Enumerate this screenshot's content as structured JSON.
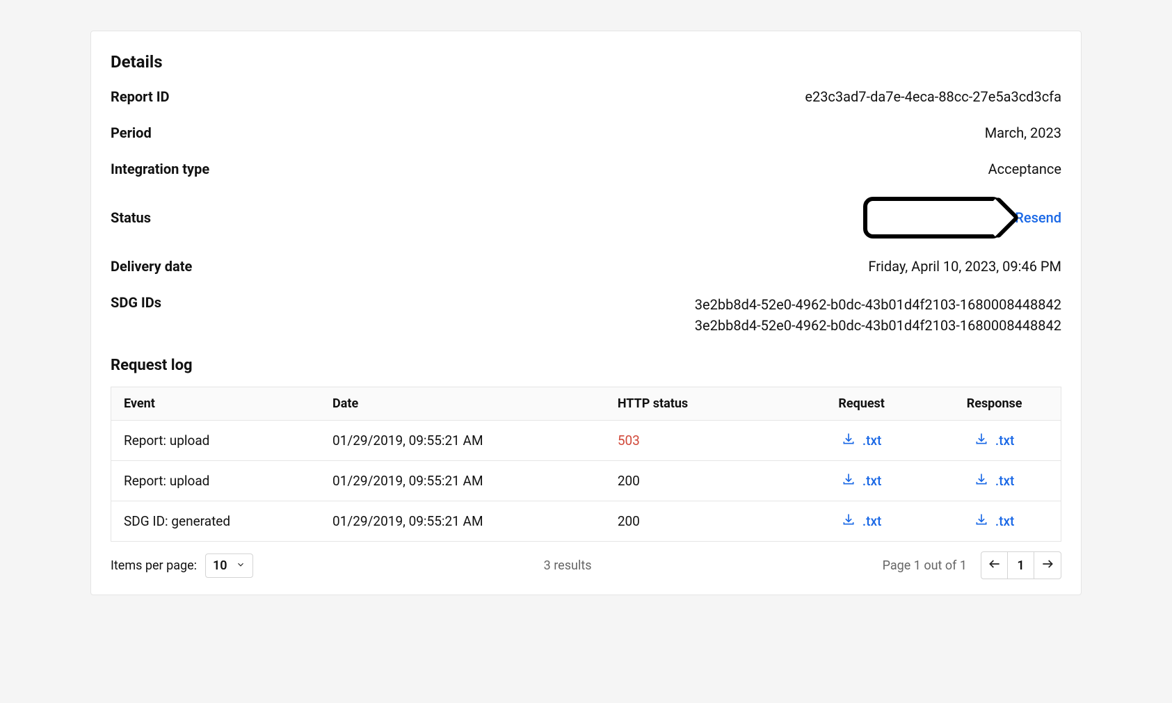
{
  "details": {
    "title": "Details",
    "rows": {
      "report_id": {
        "label": "Report ID",
        "value": "e23c3ad7-da7e-4eca-88cc-27e5a3cd3cfa"
      },
      "period": {
        "label": "Period",
        "value": "March, 2023"
      },
      "integration_type": {
        "label": "Integration type",
        "value": "Acceptance"
      },
      "status": {
        "label": "Status",
        "resend": "Resend"
      },
      "delivery_date": {
        "label": "Delivery date",
        "value": "Friday, April 10, 2023, 09:46 PM"
      },
      "sdg_ids": {
        "label": "SDG IDs",
        "values": [
          "3e2bb8d4-52e0-4962-b0dc-43b01d4f2103-1680008448842",
          "3e2bb8d4-52e0-4962-b0dc-43b01d4f2103-1680008448842"
        ]
      }
    }
  },
  "request_log": {
    "title": "Request log",
    "headers": {
      "event": "Event",
      "date": "Date",
      "http_status": "HTTP status",
      "request": "Request",
      "response": "Response"
    },
    "download_label": ".txt",
    "rows": [
      {
        "event": "Report: upload",
        "date": "01/29/2019, 09:55:21 AM",
        "http_status": "503",
        "is_error": true
      },
      {
        "event": "Report: upload",
        "date": "01/29/2019, 09:55:21 AM",
        "http_status": "200",
        "is_error": false
      },
      {
        "event": "SDG ID: generated",
        "date": "01/29/2019, 09:55:21 AM",
        "http_status": "200",
        "is_error": false
      }
    ]
  },
  "pagination": {
    "items_per_page_label": "Items per page:",
    "items_per_page_value": "10",
    "results_text": "3 results",
    "page_text": "Page 1 out of 1",
    "current_page": "1"
  }
}
